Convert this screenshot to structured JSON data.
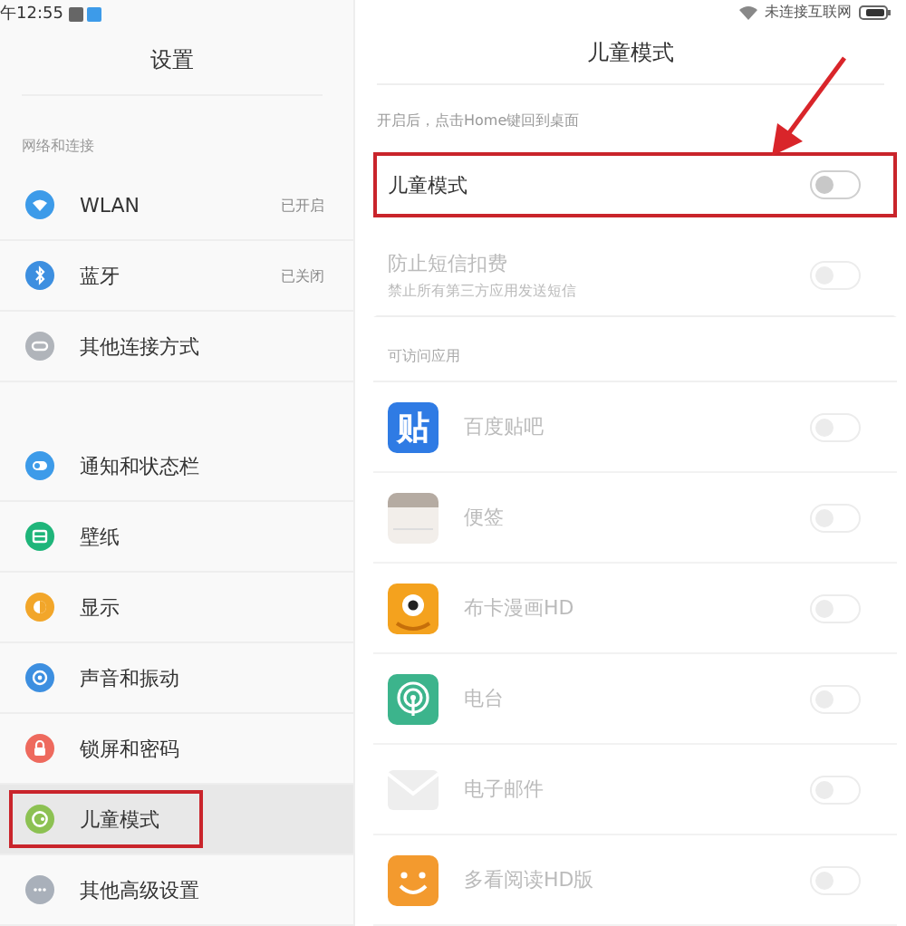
{
  "status_bar": {
    "time": "午12:55",
    "network": "未连接互联网"
  },
  "sidebar": {
    "title": "设置",
    "groups": [
      {
        "title": "网络和连接",
        "items": [
          {
            "kind": "wifi",
            "label": "WLAN",
            "value": "已开启",
            "color": "#3d9be9",
            "selected": false,
            "highlighted": false
          },
          {
            "kind": "bluetooth",
            "label": "蓝牙",
            "value": "已关闭",
            "color": "#3d8fe0",
            "selected": false,
            "highlighted": false
          },
          {
            "kind": "link",
            "label": "其他连接方式",
            "color": "#b0b4ba",
            "selected": false,
            "highlighted": false
          }
        ]
      },
      {
        "items": [
          {
            "kind": "toggle",
            "label": "通知和状态栏",
            "color": "#3d9be9",
            "selected": false,
            "highlighted": false
          },
          {
            "kind": "frame",
            "label": "壁纸",
            "color": "#1fb57a",
            "selected": false,
            "highlighted": false
          },
          {
            "kind": "sun",
            "label": "显示",
            "color": "#f2a62a",
            "selected": false,
            "highlighted": false
          },
          {
            "kind": "speaker",
            "label": "声音和振动",
            "color": "#3d8fe0",
            "selected": false,
            "highlighted": false
          },
          {
            "kind": "lock",
            "label": "锁屏和密码",
            "color": "#ee6a5e",
            "selected": false,
            "highlighted": false
          },
          {
            "kind": "child",
            "label": "儿童模式",
            "color": "#8cc152",
            "selected": true,
            "highlighted": true
          },
          {
            "kind": "more",
            "label": "其他高级设置",
            "color": "#a9b0ba",
            "selected": false,
            "highlighted": false
          }
        ]
      }
    ]
  },
  "detail": {
    "title": "儿童模式",
    "hint": "开启后，点击Home键回到桌面",
    "settings": [
      {
        "label": "儿童模式",
        "on": false,
        "disabled": false,
        "highlighted": true
      },
      {
        "label": "防止短信扣费",
        "description": "禁止所有第三方应用发送短信",
        "on": false,
        "disabled": true,
        "highlighted": false
      }
    ],
    "apps_title": "可访问应用",
    "apps": [
      {
        "kind": "tieba",
        "icon_text": "贴",
        "label": "百度贴吧",
        "on": false
      },
      {
        "kind": "notes",
        "label": "便签",
        "on": false
      },
      {
        "kind": "comic",
        "label": "布卡漫画HD",
        "on": false
      },
      {
        "kind": "radio",
        "label": "电台",
        "on": false
      },
      {
        "kind": "mail",
        "label": "电子邮件",
        "on": false
      },
      {
        "kind": "reader",
        "label": "多看阅读HD版",
        "on": false
      }
    ]
  }
}
